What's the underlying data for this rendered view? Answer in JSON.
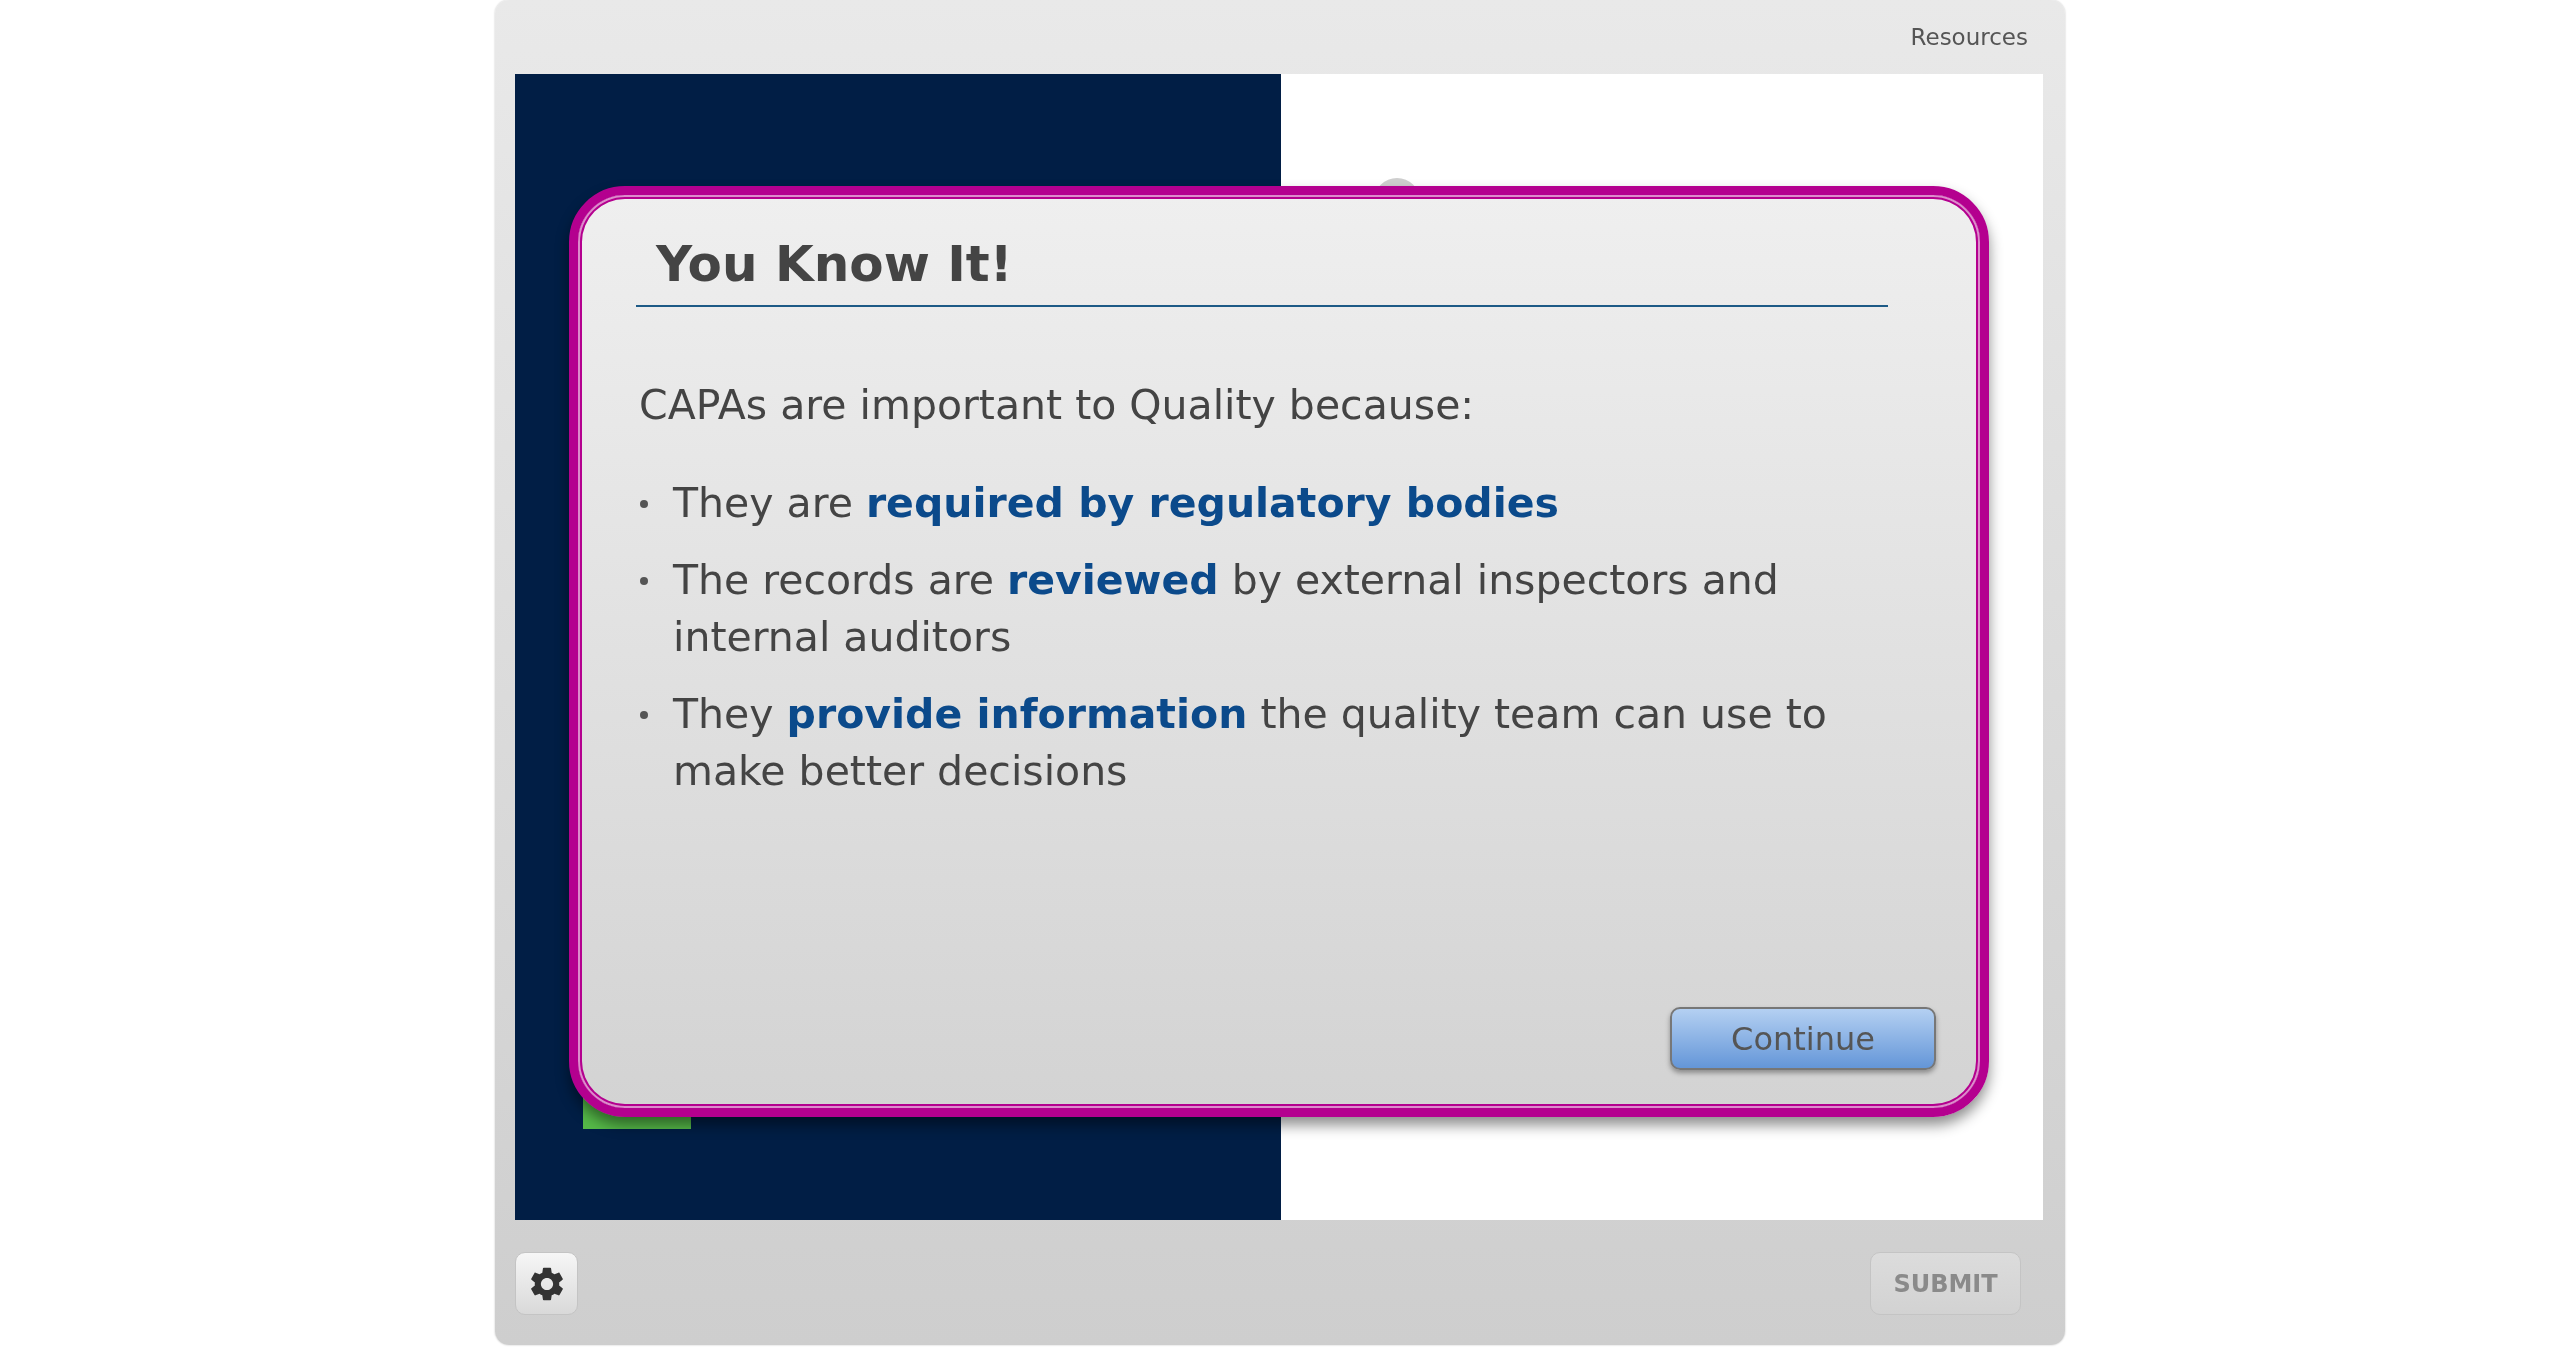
{
  "player": {
    "resources": "Resources"
  },
  "dialog": {
    "title": "You Know It!",
    "intro": "CAPAs are important to Quality because:",
    "bullets": [
      "They are **required by regulatory bodies**",
      "The records are **reviewed** by external inspectors and internal auditors",
      "They **provide information** the quality team can use to make better decisions"
    ],
    "button": "Continue"
  },
  "footer": {
    "submit": {
      "label": "SUBMIT",
      "disabled": true
    }
  }
}
